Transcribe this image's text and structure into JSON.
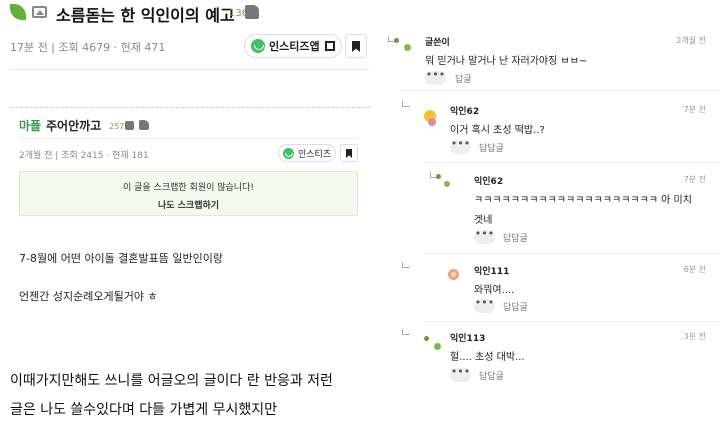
{
  "post": {
    "title": "소름돋는 한 익인이의 예고",
    "likes": "136",
    "meta": "17분 전  |  조회 4679 · 현재 471",
    "app_button": "인스티즈앱"
  },
  "quoted_post": {
    "cafe": "마플",
    "title": "주어안까고",
    "likes": "257",
    "meta": "2개월 전  |  조회 2415 · 현재 181",
    "app_button": "인스티즈",
    "scrap_notice": "이 글을 스크랩한 회원이 많습니다!",
    "scrap_button": "나도 스크랩하기",
    "body_lines": [
      "7-8월에 어떤 아이돌 결혼발표뜸 일반인이랑",
      "언젠간 성지순례오게될거야 ㅎ"
    ]
  },
  "caption_lines": [
    "이때가지만해도 쓰니를 어글오의 글이다 란 반응과 저런",
    "글은 나도 쓸수있다며 다들 가볍게 무시했지만"
  ],
  "comments": [
    {
      "name": "글쓴이",
      "time": "2개월 전",
      "text": "뭐 믿거나 말거나 난 자러가야징 ㅂㅂ~",
      "more": "•••",
      "reply": "답글"
    },
    {
      "name": "익인62",
      "time": "7분 전",
      "text": "이거 혹시 초성 떡밥..?",
      "more": "•••",
      "reply": "답답글"
    },
    {
      "name": "익인62",
      "time": "7분 전",
      "text": "ㅋㅋㅋㅋㅋㅋㅋㅋㅋㅋㅋㅋㅋㅋㅋㅋㅋㅋㅋㅋ 아 미치",
      "text2": "겟네",
      "more": "•••",
      "reply": "답답글"
    },
    {
      "name": "익인111",
      "time": "6분 전",
      "text": "와뭐여....",
      "more": "•••",
      "reply": "답답글"
    },
    {
      "name": "익인113",
      "time": "3분 전",
      "text": "헐.... 초성 대박...",
      "more": "•••",
      "reply": "답답글"
    }
  ],
  "colors": {
    "brand_green": "#5fb236",
    "scrap_bg": "#f3f9ec"
  }
}
